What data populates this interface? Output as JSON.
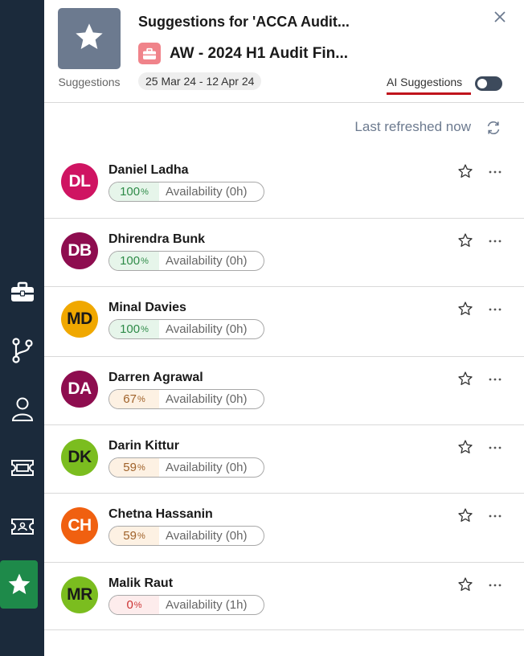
{
  "header": {
    "logo_caption": "Suggestions",
    "title": "Suggestions for 'ACCA Audit...",
    "subtitle": "AW - 2024 H1 Audit Fin...",
    "date_range": "25 Mar 24 - 12 Apr 24",
    "ai_suggestions_label": "AI Suggestions",
    "ai_suggestions_enabled": false
  },
  "refresh": {
    "text": "Last refreshed now"
  },
  "colors": {
    "sidebar_bg": "#1b2a3b",
    "active_nav": "#1e8a4a",
    "logo_bg": "#6c7a8f",
    "briefcase_bg": "#f0838a",
    "ai_underline": "#c0141c"
  },
  "sidebar": {
    "items": [
      {
        "icon": "briefcase-icon"
      },
      {
        "icon": "branch-icon"
      },
      {
        "icon": "person-icon"
      },
      {
        "icon": "ticket-icon"
      },
      {
        "icon": "id-card-icon"
      },
      {
        "icon": "star-icon",
        "active": true
      }
    ]
  },
  "people": [
    {
      "initials": "DL",
      "name": "Daniel Ladha",
      "percent": "100",
      "percent_symbol": "%",
      "availability": "Availability (0h)",
      "avatar_color": "#cf1462",
      "initials_color": "#ffffff",
      "pct_bg": "#e6f5ea",
      "pct_color": "#2e8b48"
    },
    {
      "initials": "DB",
      "name": "Dhirendra Bunk",
      "percent": "100",
      "percent_symbol": "%",
      "availability": "Availability (0h)",
      "avatar_color": "#8e0d4f",
      "initials_color": "#ffffff",
      "pct_bg": "#e6f5ea",
      "pct_color": "#2e8b48"
    },
    {
      "initials": "MD",
      "name": "Minal Davies",
      "percent": "100",
      "percent_symbol": "%",
      "availability": "Availability (0h)",
      "avatar_color": "#f0a800",
      "initials_color": "#1a1a1a",
      "pct_bg": "#e6f5ea",
      "pct_color": "#2e8b48"
    },
    {
      "initials": "DA",
      "name": "Darren Agrawal",
      "percent": "67",
      "percent_symbol": "%",
      "availability": "Availability (0h)",
      "avatar_color": "#8e0d4f",
      "initials_color": "#ffffff",
      "pct_bg": "#fdf1e3",
      "pct_color": "#a0622a"
    },
    {
      "initials": "DK",
      "name": "Darin Kittur",
      "percent": "59",
      "percent_symbol": "%",
      "availability": "Availability (0h)",
      "avatar_color": "#7bbd1f",
      "initials_color": "#1a1a1a",
      "pct_bg": "#fdf1e3",
      "pct_color": "#a0622a"
    },
    {
      "initials": "CH",
      "name": "Chetna Hassanin",
      "percent": "59",
      "percent_symbol": "%",
      "availability": "Availability (0h)",
      "avatar_color": "#f06010",
      "initials_color": "#ffffff",
      "pct_bg": "#fdf1e3",
      "pct_color": "#a0622a"
    },
    {
      "initials": "MR",
      "name": "Malik Raut",
      "percent": "0",
      "percent_symbol": "%",
      "availability": "Availability (1h)",
      "avatar_color": "#7bbd1f",
      "initials_color": "#1a1a1a",
      "pct_bg": "#fdecec",
      "pct_color": "#cc3333"
    }
  ]
}
